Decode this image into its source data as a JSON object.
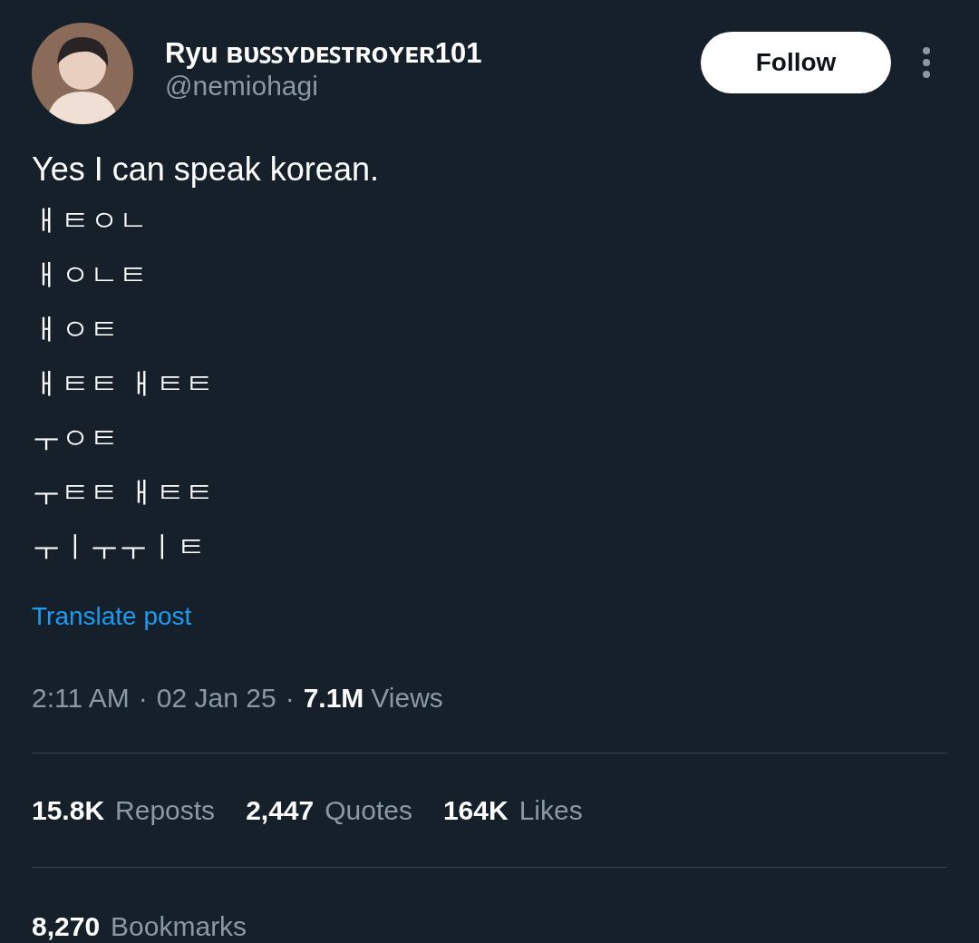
{
  "author": {
    "display_name": "Ryu ʙᴜꜱꜱʏᴅᴇꜱᴛʀᴏʏᴇʀ101",
    "handle": "@nemiohagi"
  },
  "follow_button": "Follow",
  "post": {
    "lines": [
      "Yes I can speak korean.",
      "ㅐㅌㅇㄴ",
      "ㅐㅇㄴㅌ",
      "ㅐㅇㅌ",
      "ㅐㅌㅌ ㅐㅌㅌ",
      "ㅜㅇㅌ",
      "ㅜㅌㅌ ㅐㅌㅌ",
      "ㅜㅣㅜㅜㅣㅌ"
    ],
    "translate_link": "Translate post"
  },
  "meta": {
    "time": "2:11 AM",
    "separator_1": "·",
    "date": "02 Jan 25",
    "separator_2": "·",
    "views_count": "7.1M",
    "views_label": "Views"
  },
  "stats": [
    {
      "count": "15.8K",
      "label": "Reposts"
    },
    {
      "count": "2,447",
      "label": "Quotes"
    },
    {
      "count": "164K",
      "label": "Likes"
    }
  ],
  "bookmarks": {
    "count": "8,270",
    "label": "Bookmarks"
  }
}
